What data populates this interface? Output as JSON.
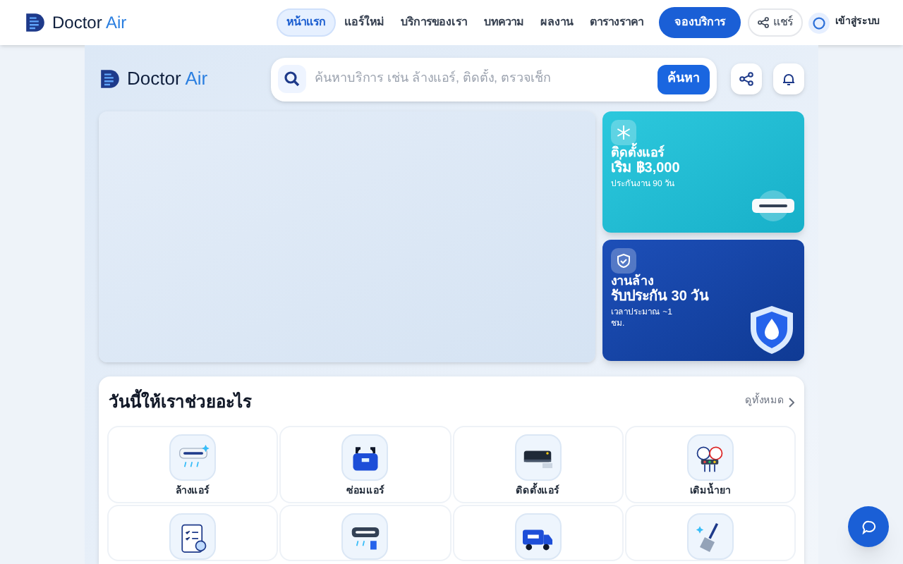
{
  "top_brand": {
    "name": "Doctor",
    "accent": "Air"
  },
  "header_brand": {
    "name": "Doctor",
    "accent": "Air"
  },
  "nav": [
    {
      "label": "หน้าแรก",
      "selected": true
    },
    {
      "label": "แอร์ใหม่",
      "selected": false
    },
    {
      "label": "บริการของเรา",
      "selected": false
    },
    {
      "label": "บทความ",
      "selected": false
    },
    {
      "label": "ผลงาน",
      "selected": false
    },
    {
      "label": "ตารางราคา",
      "selected": false
    }
  ],
  "book_button": "จองบริการ",
  "share_button": "แชร์",
  "login": "เข้าสู่ระบบ",
  "search": {
    "placeholder": "ค้นหาบริการ เช่น ล้างแอร์, ติดตั้ง, ตรวจเช็ก",
    "button": "ค้นหา"
  },
  "promos": [
    {
      "kind": "install",
      "title": "ติดตั้งแอร์",
      "headline": "เริ่ม ฿3,000",
      "note": "ประกันงาน 90 วัน"
    },
    {
      "kind": "clean",
      "title": "งานล้าง",
      "headline": "รับประกัน 30 วัน",
      "note": "เวลาประมาณ ~1 ชม."
    }
  ],
  "services_section": {
    "title": "วันนี้ให้เราช่วยอะไร",
    "see_all": "ดูทั้งหมด",
    "items": [
      {
        "label": "ล้างแอร์"
      },
      {
        "label": "ซ่อมแอร์"
      },
      {
        "label": "ติดตั้งแอร์"
      },
      {
        "label": "เติมน้ำยา"
      }
    ],
    "second_row_visible": true
  }
}
